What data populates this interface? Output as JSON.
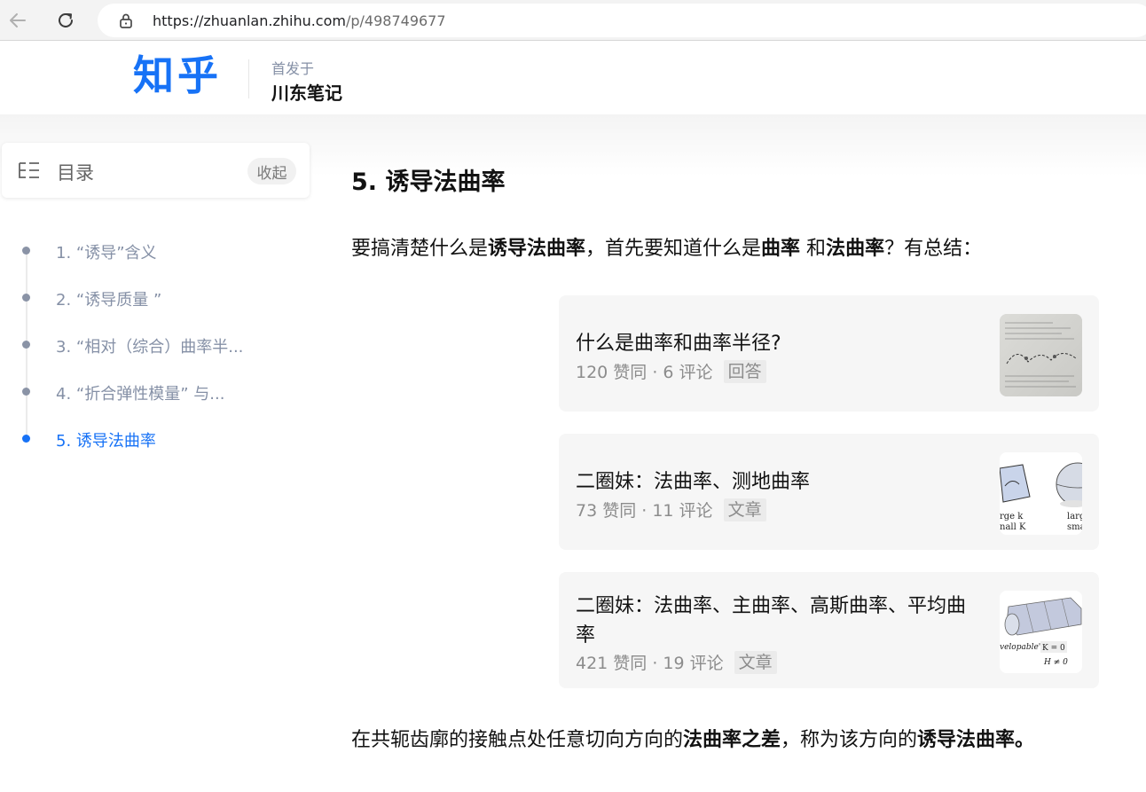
{
  "browser": {
    "url_host": "https://zhuanlan.zhihu.com",
    "url_path": "/p/498749677"
  },
  "header": {
    "logo": "知乎",
    "published_label": "首发于",
    "column_name": "川东笔记"
  },
  "toc": {
    "title": "目录",
    "collapse_label": "收起",
    "items": [
      {
        "label": "1. “诱导”含义"
      },
      {
        "label": "2. “诱导质量 ”"
      },
      {
        "label": "3. “相对（综合）曲率半..."
      },
      {
        "label": "4. “折合弹性模量” 与..."
      },
      {
        "label": "5. 诱导法曲率"
      }
    ],
    "active_index": 4
  },
  "article": {
    "heading": "5. 诱导法曲率",
    "intro": {
      "p1": "要搞清楚什么是",
      "b1": "诱导法曲率",
      "p2": "，首先要知道什么是",
      "b2": "曲率",
      "p3": " 和",
      "b3": "法曲率",
      "p4": "？有总结："
    },
    "cards": [
      {
        "title": "什么是曲率和曲率半径?",
        "meta": "120 赞同 · 6 评论",
        "tag": "回答"
      },
      {
        "title": "二圈妹：法曲率、测地曲率",
        "meta": "73 赞同 · 11 评论",
        "tag": "文章"
      },
      {
        "title": "二圈妹：法曲率、主曲率、高斯曲率、平均曲率",
        "meta": "421 赞同 · 19 评论",
        "tag": "文章"
      }
    ],
    "closing": {
      "p1": "在共轭齿廓的接触点处任意切向方向的",
      "b1": "法曲率之差",
      "p2": "，称为该方向的",
      "b2": "诱导法曲率。"
    },
    "thumb2_labels": {
      "a": "rge k",
      "b": "nall K",
      "c": "larg",
      "d": "sma"
    },
    "thumb3_labels": {
      "a": "velopable\"",
      "b": "K = 0",
      "c": "H ≠ 0"
    }
  },
  "colors": {
    "brand": "#1772f6",
    "toc_text": "#8590a6",
    "card_bg": "#f6f6f6"
  },
  "icons": [
    "back-arrow-icon",
    "reload-icon",
    "lock-icon",
    "toc-list-icon"
  ]
}
